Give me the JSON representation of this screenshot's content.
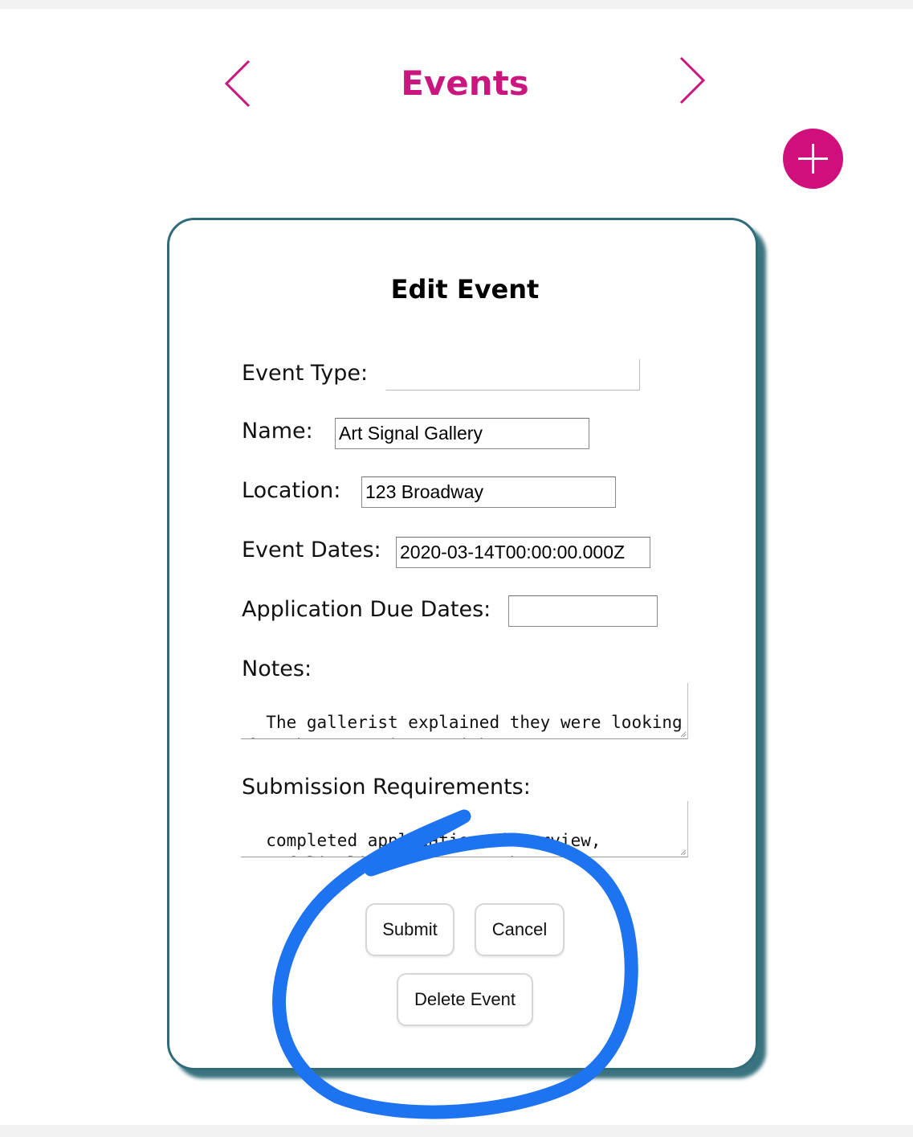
{
  "header": {
    "title": "Events",
    "prev_icon": "chevron-left-icon",
    "next_icon": "chevron-right-icon",
    "add_icon": "plus-icon"
  },
  "colors": {
    "accent": "#c9177f",
    "add_button": "#d10f7c",
    "card_border": "#2f6b78",
    "annotation": "#1e73f0"
  },
  "form": {
    "title": "Edit Event",
    "event_type": {
      "label": "Event Type:",
      "value": ""
    },
    "name": {
      "label": "Name:",
      "value": "Art Signal Gallery"
    },
    "location": {
      "label": "Location:",
      "value": "123 Broadway"
    },
    "event_dates": {
      "label": "Event Dates:",
      "value": "2020-03-14T00:00:00.000Z"
    },
    "application_due_dates": {
      "label": "Application Due Dates:",
      "value": ""
    },
    "notes": {
      "label": "Notes:",
      "value": "The gallerist explained they were looking for abstract pieces with warm"
    },
    "submission_requirements": {
      "label": "Submission Requirements:",
      "value": "completed application, interview, portfolio link, volunteer hours"
    }
  },
  "buttons": {
    "submit": "Submit",
    "cancel": "Cancel",
    "delete": "Delete Event"
  }
}
